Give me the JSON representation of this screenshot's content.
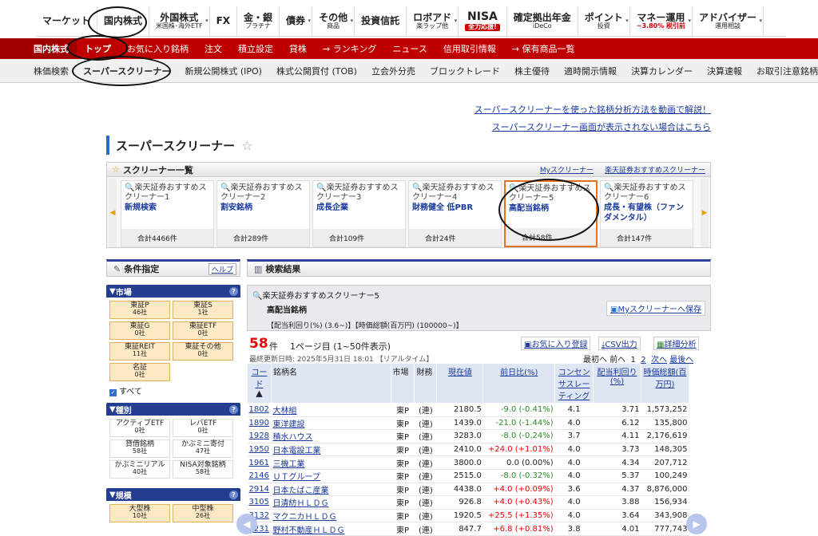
{
  "global_nav": [
    {
      "label": "マーケット",
      "sub": ""
    },
    {
      "label": "国内株式",
      "sub": ""
    },
    {
      "label": "外国株式",
      "sub": "米国株･海外ETF",
      "dd": "▾"
    },
    {
      "label": "FX",
      "sub": ""
    },
    {
      "label": "金・銀",
      "sub": "プラチナ"
    },
    {
      "label": "債券",
      "sub": "",
      "dd": "▾"
    },
    {
      "label": "その他",
      "sub": "商品",
      "dd": "▾"
    },
    {
      "label": "投資信託",
      "sub": ""
    },
    {
      "label": "ロボアド",
      "sub": "楽ラップ他",
      "dd": "▾"
    },
    {
      "label": "NISA",
      "sub": "全力応援!"
    },
    {
      "label": "確定拠出年金",
      "sub": "iDeCo"
    },
    {
      "label": "ポイント",
      "sub": "投資",
      "dd": "▾"
    },
    {
      "label": "マネー運用",
      "sub": "~3.80% 税引前",
      "dd": "▾"
    },
    {
      "label": "アドバイザー",
      "sub": "運用相談",
      "dd": "▾"
    }
  ],
  "local_nav": {
    "category": "国内株式",
    "items": [
      "トップ",
      "お気に入り銘柄",
      "注文",
      "積立設定",
      "貸株",
      "→ ランキング",
      "ニュース",
      "信用取引情報",
      "→ 保有商品一覧"
    ]
  },
  "sub_nav": [
    "株価検索",
    "スーパースクリーナー",
    "新規公開株式 (IPO)",
    "株式公開買付 (TOB)",
    "立会外分売",
    "ブロックトレード",
    "株主優待",
    "適時開示情報",
    "決算カレンダー",
    "決算速報",
    "お取引注意銘柄"
  ],
  "help_links": [
    "スーパースクリーナーを使った銘柄分析方法を動画で解説！",
    "スーパースクリーナー画面が表示されない場合はこちら"
  ],
  "page_title": "スーパースクリーナー",
  "screener_list": {
    "title": "スクリーナー一覧",
    "my_link": "Myスクリーナー",
    "rec_link": "楽天証券おすすめスクリーナー",
    "cards": [
      {
        "caption": "楽天証券おすすめスクリーナー1",
        "name": "新規検索",
        "total": "合計4466件"
      },
      {
        "caption": "楽天証券おすすめスクリーナー2",
        "name": "割安銘柄",
        "total": "合計289件"
      },
      {
        "caption": "楽天証券おすすめスクリーナー3",
        "name": "成長企業",
        "total": "合計109件"
      },
      {
        "caption": "楽天証券おすすめスクリーナー4",
        "name": "財務健全 低PBR",
        "total": "合計24件"
      },
      {
        "caption": "楽天証券おすすめスクリーナー5",
        "name": "高配当銘柄",
        "total": "合計58件"
      },
      {
        "caption": "楽天証券おすすめスクリーナー6",
        "name": "成長・有望株（ファンダメンタル）",
        "total": "合計147件"
      }
    ]
  },
  "conditions": {
    "title": "条件指定",
    "help": "ヘルプ",
    "market": {
      "title": "市場",
      "items": [
        {
          "l": "東証P",
          "n": "46社"
        },
        {
          "l": "東証S",
          "n": "1社"
        },
        {
          "l": "東証G",
          "n": "0社"
        },
        {
          "l": "東証ETF",
          "n": "0社"
        },
        {
          "l": "東証REIT",
          "n": "11社"
        },
        {
          "l": "東証その他",
          "n": "0社"
        },
        {
          "l": "名証",
          "n": "0社"
        }
      ],
      "all": "すべて"
    },
    "kind": {
      "title": "種別",
      "items": [
        {
          "l": "アクティブETF",
          "n": "0社"
        },
        {
          "l": "レバETF",
          "n": "0社"
        },
        {
          "l": "貸借銘柄",
          "n": "58社"
        },
        {
          "l": "かぶミニ寄付",
          "n": "47社"
        },
        {
          "l": "かぶミニリアル",
          "n": "40社"
        },
        {
          "l": "NISA対象銘柄",
          "n": "58社"
        }
      ]
    },
    "scale": {
      "title": "規模",
      "items": [
        {
          "l": "大型株",
          "n": "10社"
        },
        {
          "l": "中型株",
          "n": "26社"
        }
      ]
    }
  },
  "results": {
    "title": "検索結果",
    "screener_name": "楽天証券おすすめスクリーナー5",
    "preset": "高配当銘柄",
    "criteria": "【配当利回り(%) (3.6~)】【時価総額(百万円) (100000~)】",
    "save_label": "Myスクリーナーへ保存",
    "count": "58",
    "count_unit": "件",
    "page_info": "1ページ目 (1~50件表示)",
    "updated": "最終更新日時: 2025年5月31日 18:01 【リアルタイム】",
    "fav_btn": "お気に入り登録",
    "csv_btn": "CSV出力",
    "detail_btn": "詳細分析",
    "pager": {
      "first": "最初へ",
      "prev": "前へ",
      "p1": "1",
      "p2": "2",
      "next": "次へ",
      "last": "最後へ"
    },
    "headers": [
      "コード",
      "銘柄名",
      "市場",
      "財務",
      "現在値",
      "前日比(%)",
      "コンセンサスレーティング",
      "配当利回り(%)",
      "時価総額(百万円)"
    ],
    "sort_mark": "▲",
    "rows": [
      [
        "1802",
        "大林組",
        "東P",
        "(連)",
        "2180.5",
        "-9.0 (-0.41%)",
        "4.1",
        "3.71",
        "1,573,252"
      ],
      [
        "1890",
        "東洋建設",
        "東P",
        "(連)",
        "1439.0",
        "-21.0 (-1.44%)",
        "4.0",
        "6.12",
        "135,800"
      ],
      [
        "1928",
        "積水ハウス",
        "東P",
        "(連)",
        "3283.0",
        "-8.0 (-0.24%)",
        "3.7",
        "4.11",
        "2,176,619"
      ],
      [
        "1950",
        "日本電設工業",
        "東P",
        "(連)",
        "2410.0",
        "+24.0 (+1.01%)",
        "4.0",
        "3.73",
        "148,305"
      ],
      [
        "1961",
        "三機工業",
        "東P",
        "(連)",
        "3800.0",
        "0.0 (0.00%)",
        "4.0",
        "4.34",
        "207,712"
      ],
      [
        "2146",
        "ＵＴグループ",
        "東P",
        "(連)",
        "2515.0",
        "-8.0 (-0.32%)",
        "4.0",
        "5.37",
        "100,249"
      ],
      [
        "2914",
        "日本たばこ産業",
        "東P",
        "(連)",
        "4438.0",
        "+4.0 (+0.09%)",
        "3.6",
        "4.37",
        "8,876,000"
      ],
      [
        "3105",
        "日清紡ＨＬＤＧ",
        "東P",
        "(連)",
        "926.8",
        "+4.0 (+0.43%)",
        "4.0",
        "3.88",
        "156,934"
      ],
      [
        "3132",
        "マクニカＨＬＤＧ",
        "東P",
        "(連)",
        "1920.5",
        "+25.5 (+1.35%)",
        "4.0",
        "3.64",
        "343,908"
      ],
      [
        "3231",
        "野村不動産ＨＬＤＧ",
        "東P",
        "(連)",
        "847.7",
        "+6.8 (+0.81%)",
        "3.8",
        "4.01",
        "777,743"
      ]
    ]
  }
}
